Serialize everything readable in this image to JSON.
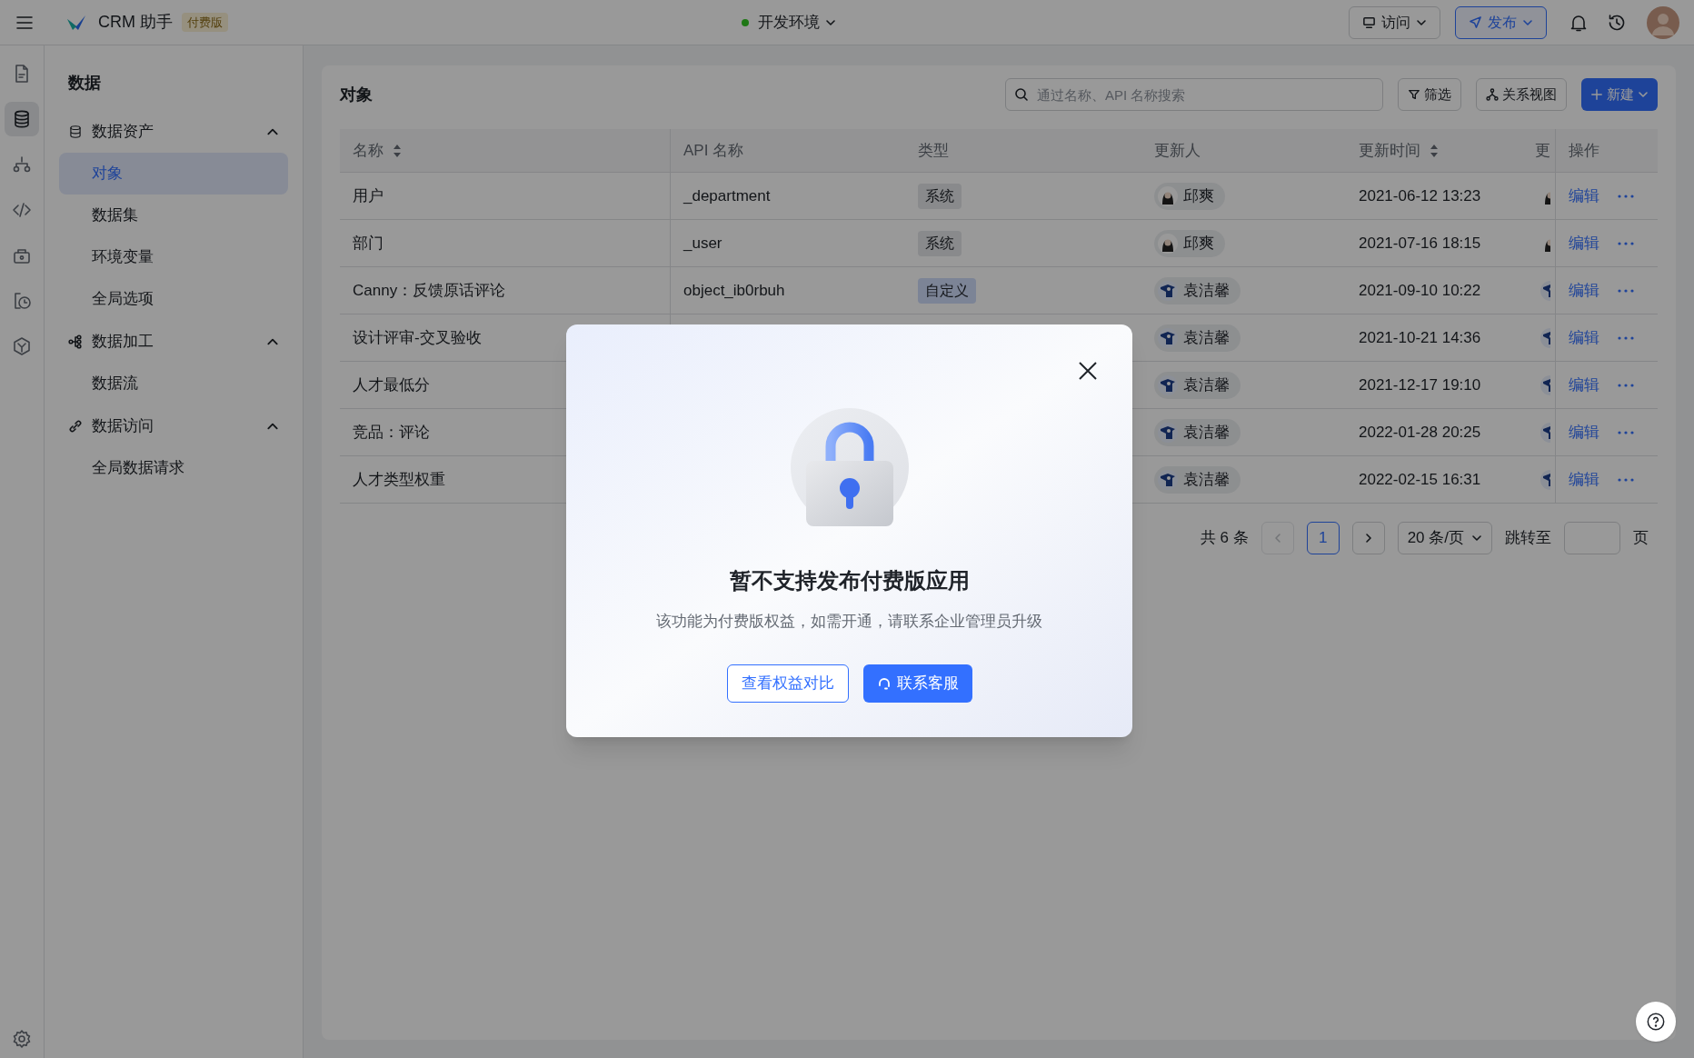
{
  "app": {
    "name": "CRM 助手",
    "badge": "付费版"
  },
  "environment": {
    "label": "开发环境"
  },
  "header_actions": [
    {
      "label": "访问",
      "kind": "visit"
    },
    {
      "label": "发布",
      "kind": "publish"
    }
  ],
  "rail_icons": [
    {
      "kind": "document",
      "selected": false
    },
    {
      "kind": "database",
      "selected": true
    },
    {
      "kind": "flow",
      "selected": false
    },
    {
      "kind": "code",
      "selected": false
    },
    {
      "kind": "lock",
      "selected": false
    },
    {
      "kind": "history",
      "selected": false
    },
    {
      "kind": "cube",
      "selected": false
    }
  ],
  "sidebar": {
    "title": "数据",
    "groups": [
      {
        "label": "数据资产",
        "kind": "assets",
        "expanded": true,
        "items": [
          {
            "label": "对象",
            "selected": true
          },
          {
            "label": "数据集",
            "selected": false
          },
          {
            "label": "环境变量",
            "selected": false
          },
          {
            "label": "全局选项",
            "selected": false
          }
        ]
      },
      {
        "label": "数据加工",
        "kind": "process",
        "expanded": true,
        "items": [
          {
            "label": "数据流",
            "selected": false
          }
        ]
      },
      {
        "label": "数据访问",
        "kind": "access",
        "expanded": true,
        "items": [
          {
            "label": "全局数据请求",
            "selected": false
          }
        ]
      }
    ]
  },
  "page": {
    "title": "对象",
    "search": {
      "placeholder": "通过名称、API 名称搜索"
    },
    "toolbar": [
      {
        "label": "筛选",
        "kind": "filter"
      },
      {
        "label": "关系视图",
        "kind": "relations"
      },
      {
        "label": "新建",
        "kind": "create"
      }
    ]
  },
  "table": {
    "columns": [
      {
        "label": "名称",
        "sortable": true
      },
      {
        "label": "API 名称",
        "sortable": false
      },
      {
        "label": "类型",
        "sortable": false
      },
      {
        "label": "更新人",
        "sortable": false
      },
      {
        "label": "更新时间",
        "sortable": true
      },
      {
        "label": "更"
      },
      {
        "label": "操作",
        "sortable": false
      }
    ],
    "rows": [
      {
        "name": "用户",
        "api_name": "_department",
        "type": "系统",
        "custom": false,
        "updater": "邱爽",
        "kind": "woman",
        "updated_at": "2021-06-12 13:23",
        "action": "编辑"
      },
      {
        "name": "部门",
        "api_name": "_user",
        "type": "系统",
        "custom": false,
        "updater": "邱爽",
        "kind": "woman",
        "updated_at": "2021-07-16 18:15",
        "action": "编辑"
      },
      {
        "name": "Canny：反馈原话评论",
        "api_name": "object_ib0rbuh",
        "type": "自定义",
        "custom": true,
        "updater": "袁洁馨",
        "kind": "mascot",
        "updated_at": "2021-09-10 10:22",
        "action": "编辑"
      },
      {
        "name": "设计评审-交叉验收",
        "updater": "袁洁馨",
        "kind": "mascot",
        "updated_at": "2021-10-21 14:36",
        "action": "编辑"
      },
      {
        "name": "人才最低分",
        "updater": "袁洁馨",
        "kind": "mascot",
        "updated_at": "2021-12-17 19:10",
        "action": "编辑"
      },
      {
        "name": "竞品：评论",
        "updater": "袁洁馨",
        "kind": "mascot",
        "updated_at": "2022-01-28 20:25",
        "action": "编辑"
      },
      {
        "name": "人才类型权重",
        "updater": "袁洁馨",
        "kind": "mascot",
        "updated_at": "2022-02-15 16:31",
        "action": "编辑"
      }
    ]
  },
  "pagination": {
    "total": "共 6 条",
    "prev": {
      "disabled": true
    },
    "pages": [
      {
        "label": "1",
        "selected": true
      }
    ],
    "next": {
      "disabled": false
    },
    "page_size": "20 条/页",
    "jump_label": "跳转至",
    "jump_suffix": "页"
  },
  "modal": {
    "title": "暂不支持发布付费版应用",
    "message": "该功能为付费版权益，如需开通，请联系企业管理员升级",
    "buttons": [
      {
        "label": "查看权益对比",
        "kind": "secondary"
      },
      {
        "label": "联系客服",
        "kind": "primary"
      }
    ]
  }
}
